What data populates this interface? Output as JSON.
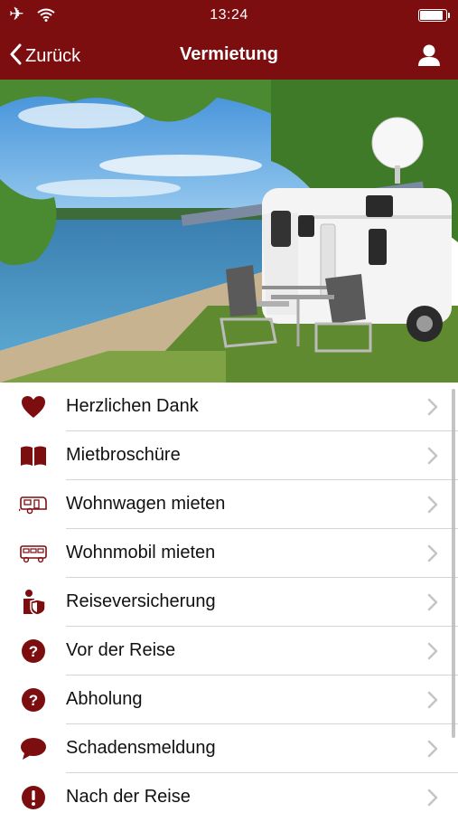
{
  "status_bar": {
    "time": "13:24",
    "icons": [
      "airplane-icon",
      "wifi-icon",
      "battery-icon"
    ],
    "battery_level": 0.95
  },
  "nav": {
    "back_label": "Zurück",
    "title": "Vermietung",
    "right_icon": "user-icon"
  },
  "hero": {
    "description_icon": "camper-photo"
  },
  "menu": {
    "items": [
      {
        "label": "Herzlichen Dank",
        "icon": "heart-icon"
      },
      {
        "label": "Mietbroschüre",
        "icon": "book-icon"
      },
      {
        "label": "Wohnwagen mieten",
        "icon": "caravan-icon"
      },
      {
        "label": "Wohnmobil mieten",
        "icon": "motorhome-icon"
      },
      {
        "label": "Reiseversicherung",
        "icon": "insurance-icon"
      },
      {
        "label": "Vor der Reise",
        "icon": "question-icon"
      },
      {
        "label": "Abholung",
        "icon": "question-icon"
      },
      {
        "label": "Schadensmeldung",
        "icon": "speech-bubble-icon"
      },
      {
        "label": "Nach der Reise",
        "icon": "exclamation-icon"
      }
    ]
  },
  "colors": {
    "brand": "#7d0e10",
    "text": "#111111",
    "separator": "#d5d5d5",
    "chevron": "#c4c4c4"
  }
}
